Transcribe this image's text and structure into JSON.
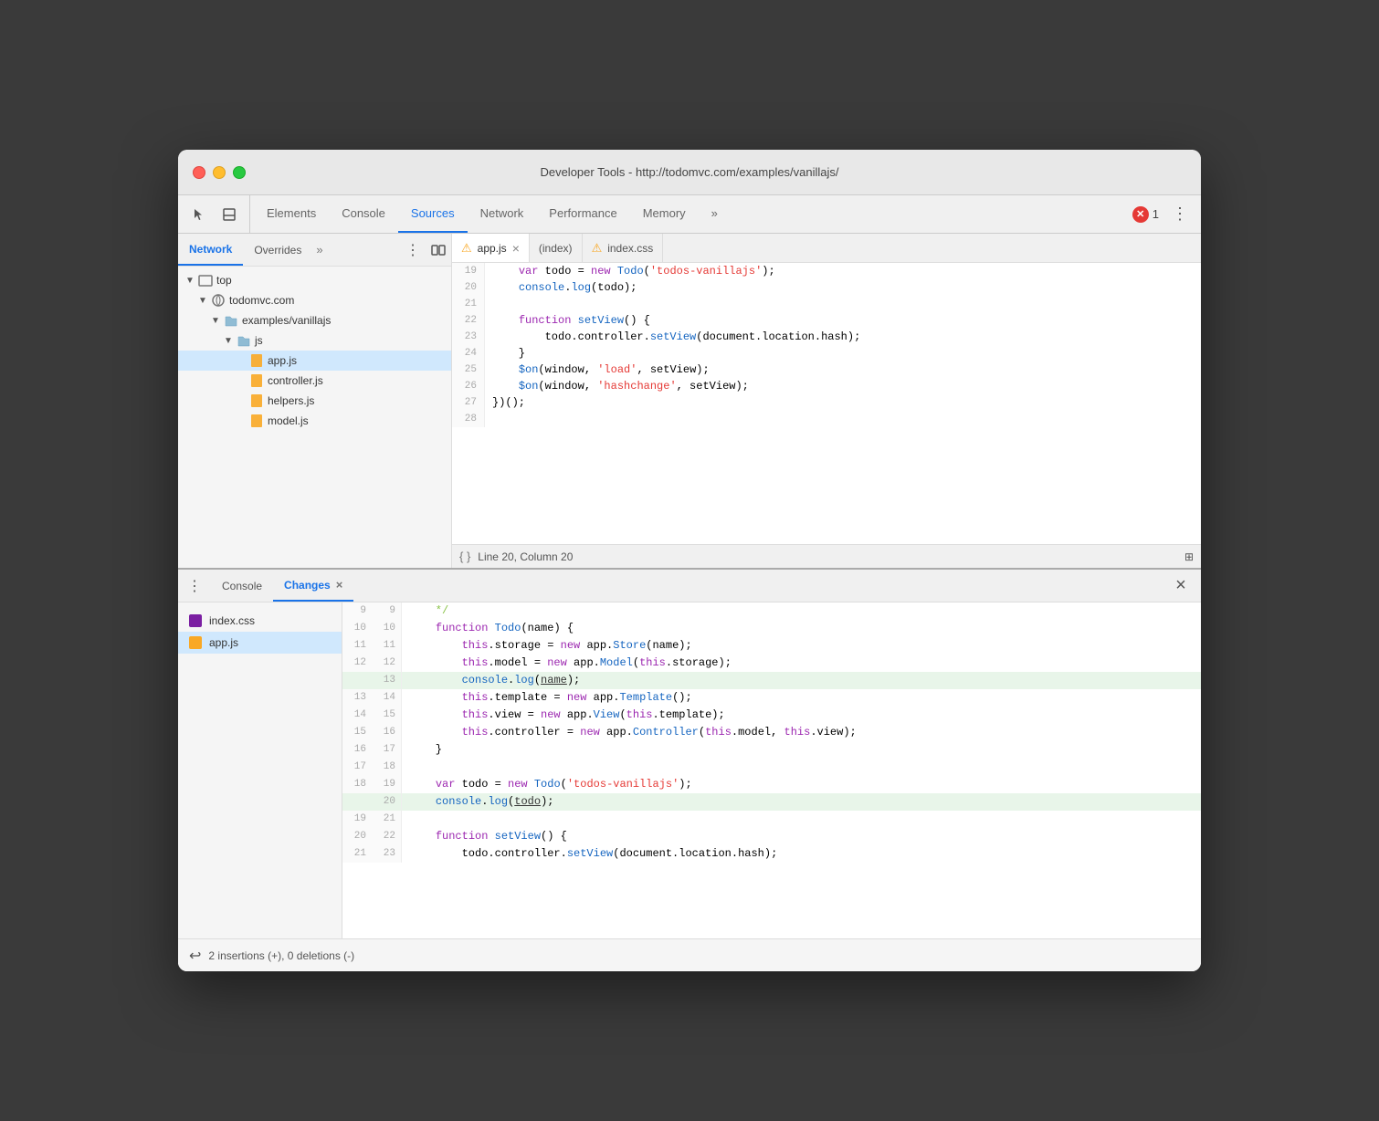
{
  "window": {
    "title": "Developer Tools - http://todomvc.com/examples/vanillajs/",
    "traffic_lights": [
      "red",
      "yellow",
      "green"
    ]
  },
  "main_toolbar": {
    "icons": [
      "cursor-icon",
      "dock-icon"
    ],
    "tabs": [
      {
        "label": "Elements",
        "active": false
      },
      {
        "label": "Console",
        "active": false
      },
      {
        "label": "Sources",
        "active": true
      },
      {
        "label": "Network",
        "active": false
      },
      {
        "label": "Performance",
        "active": false
      },
      {
        "label": "Memory",
        "active": false
      },
      {
        "label": "»",
        "active": false
      }
    ],
    "error_count": "1",
    "more_icon": "⋮"
  },
  "sidebar": {
    "tabs": [
      {
        "label": "Network",
        "active": true
      },
      {
        "label": "Overrides",
        "active": false
      },
      {
        "label": "»",
        "active": false
      }
    ],
    "file_tree": [
      {
        "level": 0,
        "type": "folder",
        "label": "top",
        "expanded": true
      },
      {
        "level": 1,
        "type": "folder-cloud",
        "label": "todomvc.com",
        "expanded": true
      },
      {
        "level": 2,
        "type": "folder",
        "label": "examples/vanillajs",
        "expanded": true
      },
      {
        "level": 3,
        "type": "folder",
        "label": "js",
        "expanded": true
      },
      {
        "level": 4,
        "type": "file-js",
        "label": "app.js"
      },
      {
        "level": 4,
        "type": "file-js",
        "label": "controller.js"
      },
      {
        "level": 4,
        "type": "file-js",
        "label": "helpers.js"
      },
      {
        "level": 4,
        "type": "file-js",
        "label": "model.js"
      }
    ]
  },
  "editor": {
    "tabs": [
      {
        "label": "app.js",
        "warning": true,
        "active": true,
        "closeable": true
      },
      {
        "label": "(index)",
        "warning": false,
        "active": false,
        "closeable": false
      },
      {
        "label": "index.css",
        "warning": true,
        "active": false,
        "closeable": false
      }
    ],
    "lines": [
      {
        "num": 19,
        "content": "    var todo = new Todo('todos-vanillajs');",
        "tokens": [
          {
            "type": "normal",
            "text": "    "
          },
          {
            "type": "kw",
            "text": "var"
          },
          {
            "type": "normal",
            "text": " todo = "
          },
          {
            "type": "kw",
            "text": "new"
          },
          {
            "type": "normal",
            "text": " "
          },
          {
            "type": "fn",
            "text": "Todo"
          },
          {
            "type": "normal",
            "text": "("
          },
          {
            "type": "str",
            "text": "'todos-vanillajs'"
          },
          {
            "type": "normal",
            "text": ");"
          }
        ]
      },
      {
        "num": 20,
        "content": "    console.log(todo);|"
      },
      {
        "num": 21,
        "content": ""
      },
      {
        "num": 22,
        "content": "    function setView() {"
      },
      {
        "num": 23,
        "content": "        todo.controller.setView(document.location.hash);"
      },
      {
        "num": 24,
        "content": "    }"
      },
      {
        "num": 25,
        "content": "    $on(window, 'load', setView);"
      },
      {
        "num": 26,
        "content": "    $on(window, 'hashchange', setView);"
      },
      {
        "num": 27,
        "content": "})();"
      },
      {
        "num": 28,
        "content": ""
      }
    ],
    "status": "Line 20, Column 20"
  },
  "bottom_pane": {
    "tabs": [
      {
        "label": "Console",
        "active": false,
        "closeable": false
      },
      {
        "label": "Changes",
        "active": true,
        "closeable": true
      }
    ],
    "files": [
      {
        "name": "index.css",
        "type": "css",
        "selected": false
      },
      {
        "name": "app.js",
        "type": "js",
        "selected": true
      }
    ],
    "diff_lines": [
      {
        "old_num": "9",
        "new_num": "9",
        "content": "    */",
        "added": false,
        "color": "comment"
      },
      {
        "old_num": "10",
        "new_num": "10",
        "content": "    function Todo(name) {",
        "added": false
      },
      {
        "old_num": "11",
        "new_num": "11",
        "content": "        this.storage = new app.Store(name);",
        "added": false
      },
      {
        "old_num": "12",
        "new_num": "12",
        "content": "        this.model = new app.Model(this.storage);",
        "added": false
      },
      {
        "old_num": "",
        "new_num": "13",
        "content": "        console.log(name);",
        "added": true
      },
      {
        "old_num": "13",
        "new_num": "14",
        "content": "        this.template = new app.Template();",
        "added": false
      },
      {
        "old_num": "14",
        "new_num": "15",
        "content": "        this.view = new app.View(this.template);",
        "added": false
      },
      {
        "old_num": "15",
        "new_num": "16",
        "content": "        this.controller = new app.Controller(this.model, this.view);",
        "added": false
      },
      {
        "old_num": "16",
        "new_num": "17",
        "content": "    }",
        "added": false
      },
      {
        "old_num": "17",
        "new_num": "18",
        "content": "",
        "added": false
      },
      {
        "old_num": "18",
        "new_num": "19",
        "content": "    var todo = new Todo('todos-vanillajs');",
        "added": false
      },
      {
        "old_num": "",
        "new_num": "20",
        "content": "    console.log(todo);",
        "added": true
      },
      {
        "old_num": "19",
        "new_num": "21",
        "content": "",
        "added": false
      },
      {
        "old_num": "20",
        "new_num": "22",
        "content": "    function setView() {",
        "added": false
      },
      {
        "old_num": "21",
        "new_num": "23",
        "content": "        todo.controller.setView(document.location.hash);",
        "added": false
      }
    ],
    "footer": "2 insertions (+), 0 deletions (-)"
  }
}
